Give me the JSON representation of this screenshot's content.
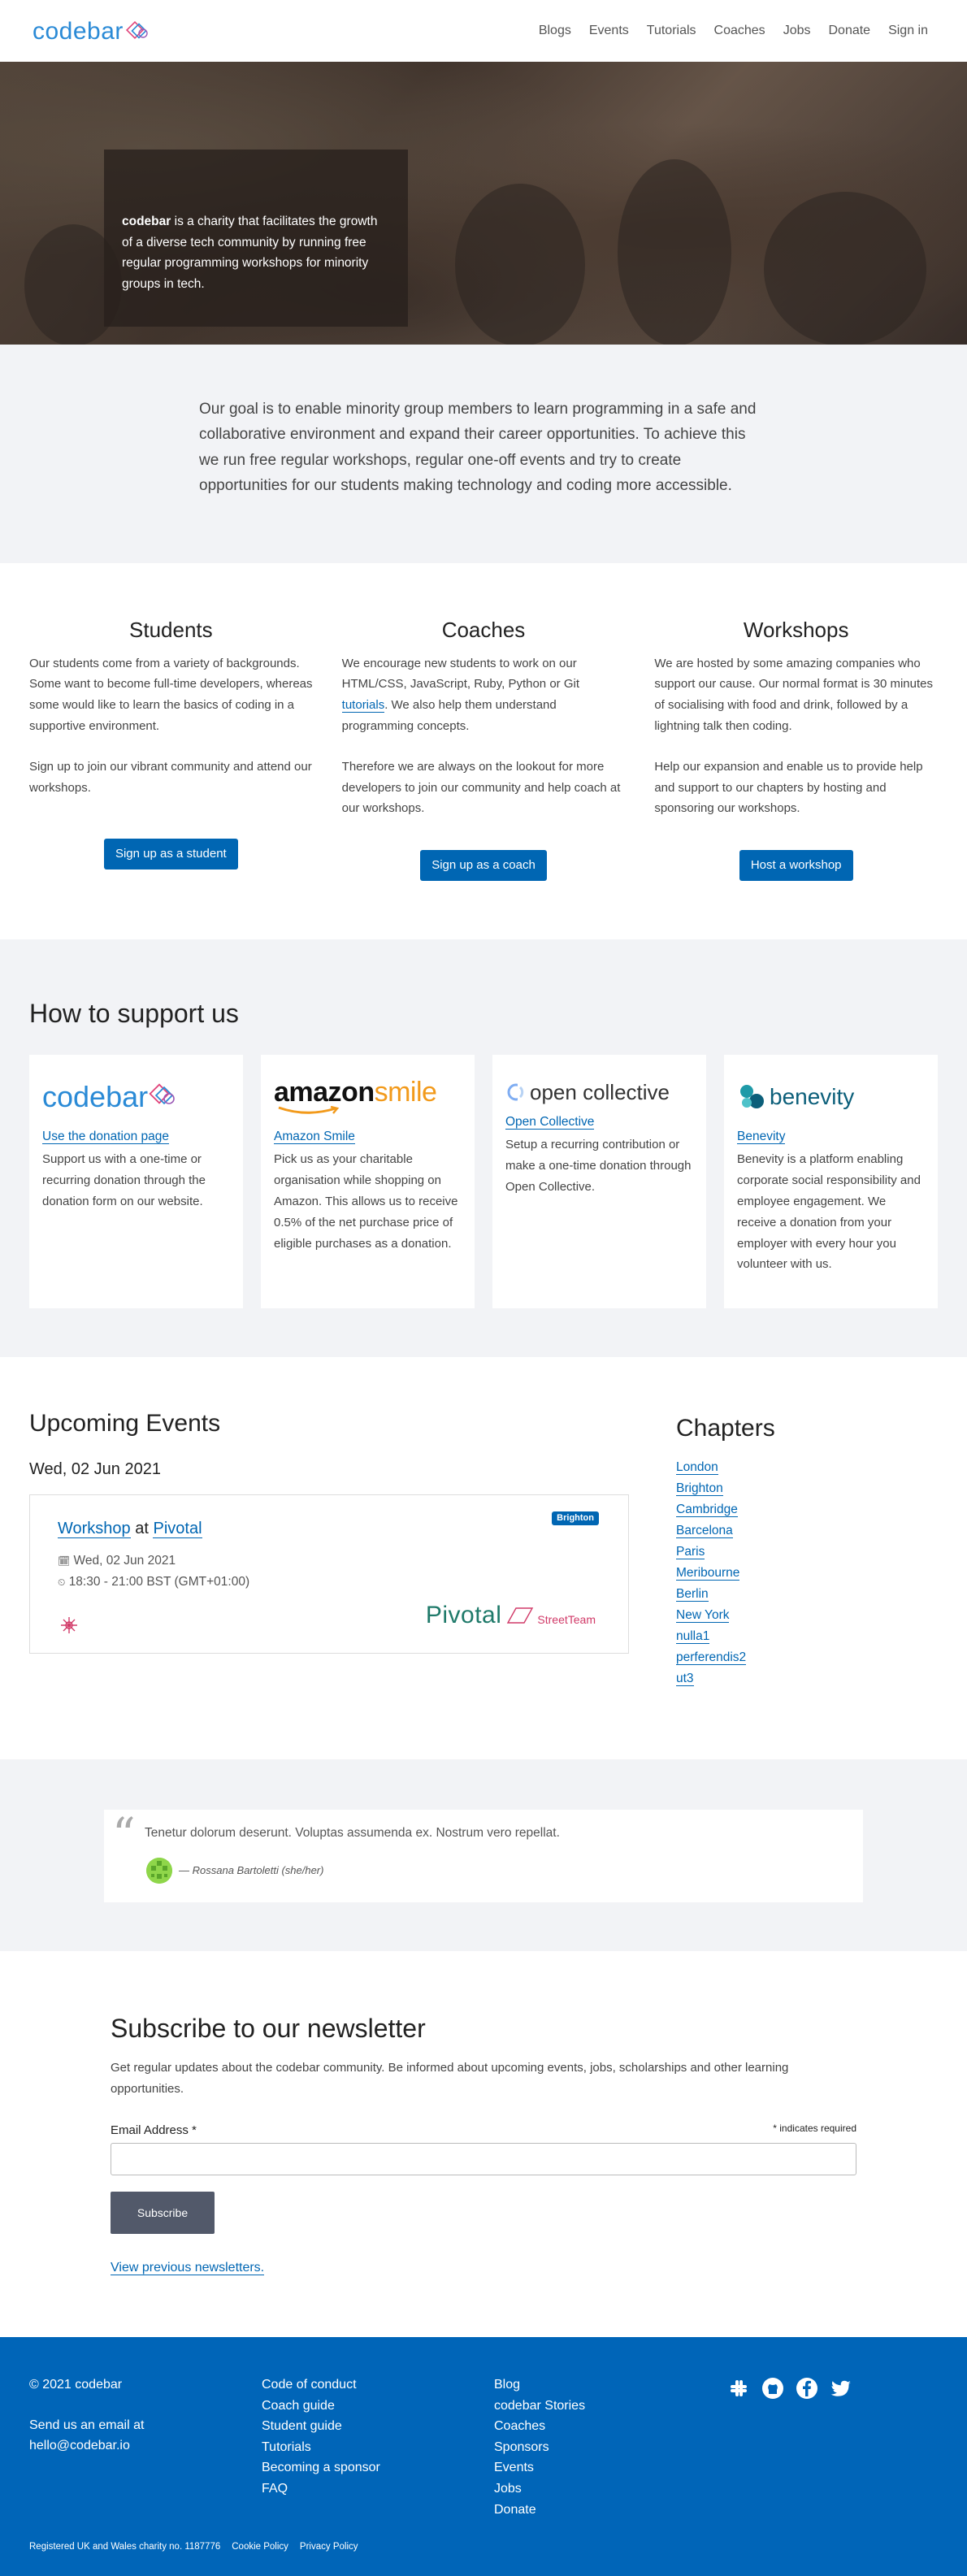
{
  "nav": {
    "logo": "codebar",
    "links": [
      "Blogs",
      "Events",
      "Tutorials",
      "Coaches",
      "Jobs",
      "Donate",
      "Sign in"
    ]
  },
  "hero": {
    "brand": "codebar",
    "text": " is a charity that facilitates the growth of a diverse tech community by running free regular programming workshops for minority groups in tech."
  },
  "goal": "Our goal is to enable minority group members to learn programming in a safe and collaborative environment and expand their career opportunities. To achieve this we run free regular workshops, regular one-off events and try to create opportunities for our students making technology and coding more accessible.",
  "roles": {
    "students": {
      "title": "Students",
      "p1": "Our students come from a variety of backgrounds. Some want to become full-time developers, whereas some would like to learn the basics of coding in a supportive environment.",
      "p2": "Sign up to join our vibrant community and attend our workshops.",
      "button": "Sign up as a student"
    },
    "coaches": {
      "title": "Coaches",
      "p1a": "We encourage new students to work on our HTML/CSS, JavaScript, Ruby, Python or Git ",
      "p1link": "tutorials",
      "p1b": ". We also help them understand programming concepts.",
      "p2": "Therefore we are always on the lookout for more developers to join our community and help coach at our workshops.",
      "button": "Sign up as a coach"
    },
    "workshops": {
      "title": "Workshops",
      "p1": "We are hosted by some amazing companies who support our cause. Our normal format is 30 minutes of socialising with food and drink, followed by a lightning talk then coding.",
      "p2": "Help our expansion and enable us to provide help and support to our chapters by hosting and sponsoring our workshops.",
      "button": "Host a workshop"
    }
  },
  "support": {
    "title": "How to support us",
    "cards": [
      {
        "logo": "codebar",
        "link": "Use the donation page",
        "text": "Support us with a one-time or recurring donation through the donation form on our website."
      },
      {
        "logo": "amazonsmile",
        "logo_a": "amazon",
        "logo_b": "smile",
        "link": "Amazon Smile",
        "text": "Pick us as your charitable organisation while shopping on Amazon. This allows us to receive 0.5% of the net purchase price of eligible purchases as a donation."
      },
      {
        "logo": "open collective",
        "link": "Open Collective",
        "text": "Setup a recurring contribution or make a one-time donation through Open Collective."
      },
      {
        "logo": "benevity",
        "link": "Benevity",
        "text": "Benevity is a platform enabling corporate social responsibility and employee engagement. We receive a donation from your employer with every hour you volunteer with us."
      }
    ]
  },
  "events": {
    "title": "Upcoming Events",
    "date": "Wed, 02 Jun 2021",
    "event": {
      "type": "Workshop",
      "at": "at",
      "host": "Pivotal",
      "badge": "Brighton",
      "date": "Wed, 02 Jun 2021",
      "time": "18:30 - 21:00 BST (GMT+01:00)",
      "sponsor_a": "Pivotal",
      "sponsor_b": "StreetTeam"
    }
  },
  "chapters": {
    "title": "Chapters",
    "items": [
      "London",
      "Brighton",
      "Cambridge",
      "Barcelona",
      "Paris",
      "Meribourne",
      "Berlin",
      "New York",
      "nulla1",
      "perferendis2",
      "ut3"
    ]
  },
  "testimonial": {
    "quote": "Tenetur dolorum deserunt. Voluptas assumenda ex. Nostrum vero repellat.",
    "author": "— Rossana Bartoletti (she/her)"
  },
  "newsletter": {
    "title": "Subscribe to our newsletter",
    "desc": "Get regular updates about the codebar community. Be informed about upcoming events, jobs, scholarships and other learning opportunities.",
    "email_label": "Email Address ",
    "required_star": "*",
    "required_note": "* indicates required",
    "button": "Subscribe",
    "prev": "View previous newsletters."
  },
  "footer": {
    "copyright": "© 2021 codebar",
    "email_line1": "Send us an email at",
    "email_line2": "hello@codebar.io",
    "col2": [
      "Code of conduct",
      "Coach guide",
      "Student guide",
      "Tutorials",
      "Becoming a sponsor",
      "FAQ"
    ],
    "col3": [
      "Blog",
      "codebar Stories",
      "Coaches",
      "Sponsors",
      "Events",
      "Jobs",
      "Donate"
    ],
    "social_icons": [
      "slack-icon",
      "github-icon",
      "facebook-icon",
      "twitter-icon"
    ],
    "charity": "Registered UK and Wales charity no. 1187776",
    "cookie": "Cookie Policy",
    "privacy": "Privacy Policy"
  },
  "colors": {
    "brand_blue": "#0066b3",
    "footer_blue": "#0065b8",
    "section_gray": "#f2f3f6"
  }
}
